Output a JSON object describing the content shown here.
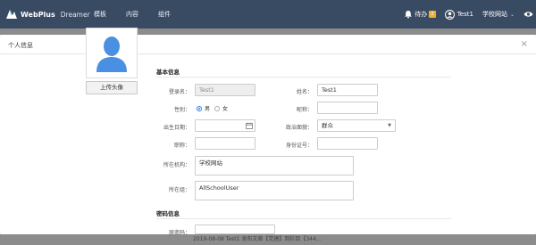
{
  "navbar": {
    "brand_name": "WebPlus",
    "brand_sub": "Dreamer",
    "menu": [
      "模板",
      "内容",
      "组件"
    ],
    "todo_label": "待办",
    "todo_count": "2",
    "user_name": "Test1",
    "site_name": "学校网站"
  },
  "modal": {
    "title": "个人信息",
    "close_glyph": "×",
    "upload_label": "上传头像",
    "basic_section": "基本信息",
    "security_section": "密码信息",
    "fields": {
      "login_label": "登录名：",
      "login_value": "Test1",
      "name_label": "姓名：",
      "name_value": "Test1",
      "gender_label": "性别：",
      "gender_male": "男",
      "gender_female": "女",
      "gender_selected": "男",
      "nickname_label": "昵称：",
      "nickname_value": "",
      "birthday_label": "出生日期：",
      "birthday_value": "",
      "politics_label": "政治面貌：",
      "politics_value": "群众",
      "title_label": "职称：",
      "title_value": "",
      "idcard_label": "身份证号：",
      "idcard_value": "",
      "org_label": "所在机构：",
      "org_value": "学校网站",
      "group_label": "所在组：",
      "group_value": "AllSchoolUser",
      "password_label": "原密码："
    }
  },
  "background": {
    "partial_text": "2019-08-08  Test1 发布文章【党建】到栏目【344..."
  },
  "colors": {
    "navbar_bg": "#394a63",
    "badge": "#f0ad2e",
    "radio_accent": "#2f7be0",
    "avatar_blue": "#4a90e2"
  }
}
